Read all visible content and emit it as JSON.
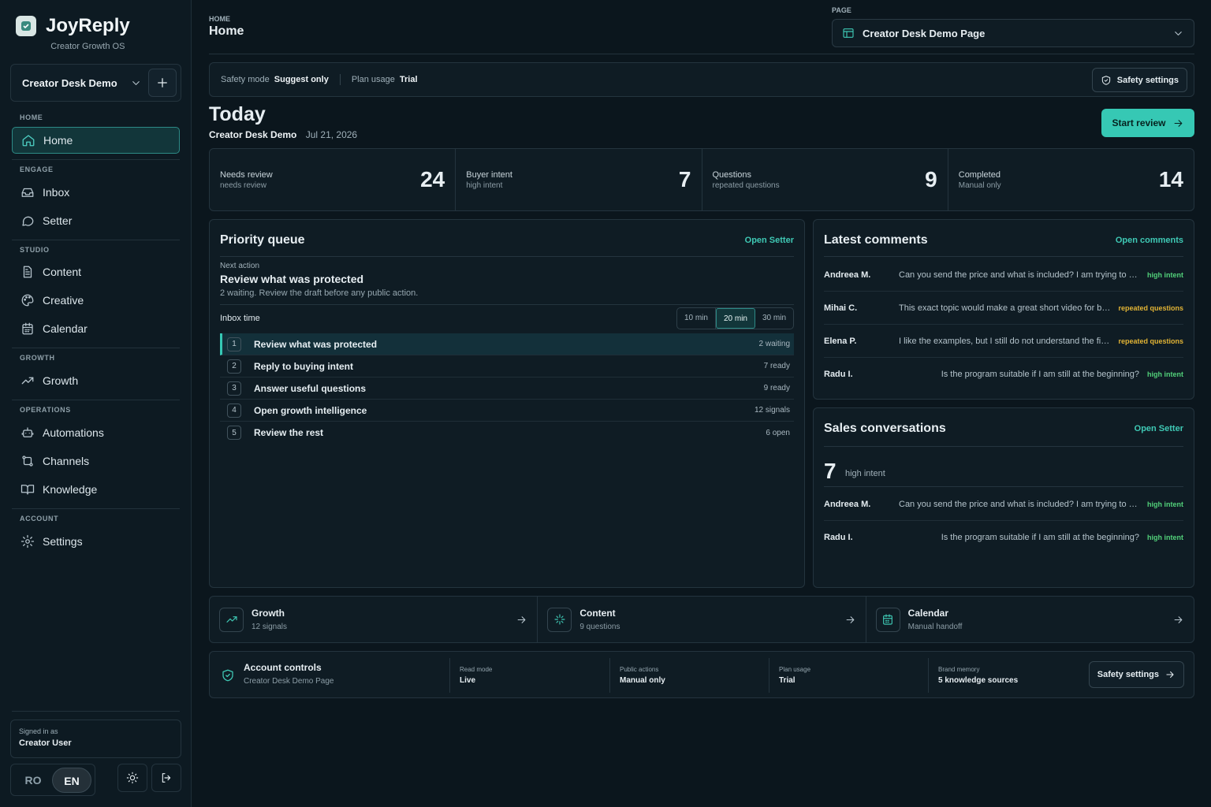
{
  "app": {
    "name": "JoyReply",
    "tagline": "Creator Growth OS"
  },
  "workspace": {
    "name": "Creator Desk Demo"
  },
  "nav": {
    "home_section": "HOME",
    "home": "Home",
    "engage_section": "ENGAGE",
    "inbox": "Inbox",
    "setter": "Setter",
    "studio_section": "STUDIO",
    "content": "Content",
    "creative": "Creative",
    "calendar": "Calendar",
    "growth_section": "GROWTH",
    "growth": "Growth",
    "operations_section": "OPERATIONS",
    "automations": "Automations",
    "channels": "Channels",
    "knowledge": "Knowledge",
    "account_section": "ACCOUNT",
    "settings": "Settings"
  },
  "user": {
    "signed_label": "Signed in as",
    "name": "Creator User"
  },
  "lang": {
    "ro": "RO",
    "en": "EN"
  },
  "header": {
    "crumb": "HOME",
    "title": "Home",
    "page_label": "PAGE",
    "page_value": "Creator Desk Demo Page"
  },
  "safety_bar": {
    "mode_label": "Safety mode",
    "mode_value": "Suggest only",
    "plan_label": "Plan usage",
    "plan_value": "Trial",
    "button": "Safety settings"
  },
  "today": {
    "title": "Today",
    "workspace": "Creator Desk Demo",
    "date": "Jul 21, 2026",
    "start_button": "Start review"
  },
  "stats": [
    {
      "label": "Needs review",
      "sub": "needs review",
      "value": "24"
    },
    {
      "label": "Buyer intent",
      "sub": "high intent",
      "value": "7"
    },
    {
      "label": "Questions",
      "sub": "repeated questions",
      "value": "9"
    },
    {
      "label": "Completed",
      "sub": "Manual only",
      "value": "14"
    }
  ],
  "priority": {
    "title": "Priority queue",
    "action": "Open Setter",
    "next_label": "Next action",
    "next_title": "Review what was protected",
    "next_desc": "2 waiting. Review the draft before any public action.",
    "inbox_time_label": "Inbox time",
    "time_options": [
      "10 min",
      "20 min",
      "30 min"
    ],
    "rows": [
      {
        "num": "1",
        "text": "Review what was protected",
        "right": "2 waiting"
      },
      {
        "num": "2",
        "text": "Reply to buying intent",
        "right": "7 ready"
      },
      {
        "num": "3",
        "text": "Answer useful questions",
        "right": "9 ready"
      },
      {
        "num": "4",
        "text": "Open growth intelligence",
        "right": "12 signals"
      },
      {
        "num": "5",
        "text": "Review the rest",
        "right": "6 open"
      }
    ]
  },
  "latest": {
    "title": "Latest comments",
    "action": "Open comments",
    "rows": [
      {
        "name": "Andreea M.",
        "text": "Can you send the price and what is included? I am trying to decide",
        "tag": "high intent"
      },
      {
        "name": "Mihai C.",
        "text": "This exact topic would make a great short video for beginners",
        "tag": "repeated questions"
      },
      {
        "name": "Elena P.",
        "text": "I like the examples, but I still do not understand the first step",
        "tag": "repeated questions"
      },
      {
        "name": "Radu I.",
        "text": "Is the program suitable if I am still at the beginning?",
        "tag": "high intent"
      }
    ]
  },
  "sales": {
    "title": "Sales conversations",
    "action": "Open Setter",
    "count": "7",
    "count_label": "high intent",
    "rows": [
      {
        "name": "Andreea M.",
        "text": "Can you send the price and what is included? I am trying to decide",
        "tag": "high intent"
      },
      {
        "name": "Radu I.",
        "text": "Is the program suitable if I am still at the beginning?",
        "tag": "high intent"
      }
    ]
  },
  "links": [
    {
      "title": "Growth",
      "sub": "12 signals",
      "icon": "trend-icon"
    },
    {
      "title": "Content",
      "sub": "9 questions",
      "icon": "sparkle-icon"
    },
    {
      "title": "Calendar",
      "sub": "Manual handoff",
      "icon": "calendar-icon"
    }
  ],
  "controls": {
    "title": "Account controls",
    "sub": "Creator Desk Demo Page",
    "items": [
      {
        "k": "Read mode",
        "v": "Live"
      },
      {
        "k": "Public actions",
        "v": "Manual only"
      },
      {
        "k": "Plan usage",
        "v": "Trial"
      },
      {
        "k": "Brand memory",
        "v": "5 knowledge sources"
      }
    ],
    "button": "Safety settings"
  },
  "colors": {
    "accent": "#36c8b4",
    "high_intent": "#52d17a",
    "repeated": "#e2b435",
    "bg": "#0b161d"
  }
}
